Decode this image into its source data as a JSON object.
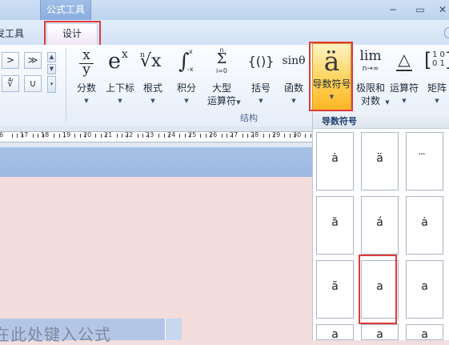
{
  "titlebar": {
    "context_tab": "公式工具",
    "minimize": "−",
    "restore": "▭",
    "close": "✕"
  },
  "tabs": {
    "developer": "发工具",
    "design": "设计"
  },
  "symbol_buttons": [
    ">",
    "≫",
    "∜",
    "∪"
  ],
  "ribbon": {
    "group_label": "结构",
    "buttons": [
      {
        "id": "fraction",
        "glyph": "x/y",
        "label": "分数"
      },
      {
        "id": "script",
        "glyph": "eˣ",
        "label": "上下标"
      },
      {
        "id": "radical",
        "glyph": "ⁿ√x",
        "label": "根式"
      },
      {
        "id": "integral",
        "glyph": "∫",
        "label": "积分"
      },
      {
        "id": "large-operator",
        "glyph": "Σ",
        "label": "大型\n运算符"
      },
      {
        "id": "bracket",
        "glyph": "{()}",
        "label": "括号"
      },
      {
        "id": "function",
        "glyph": "sinθ",
        "label": "函数"
      },
      {
        "id": "accent",
        "glyph": "ä",
        "label": "导数符号"
      },
      {
        "id": "limit-log",
        "glyph": "lim",
        "label": "极限和\n对数"
      },
      {
        "id": "operator",
        "glyph": "△",
        "label": "运算符"
      },
      {
        "id": "matrix",
        "glyph": "[10]",
        "label": "矩阵"
      }
    ]
  },
  "ruler_numbers": [
    "6",
    "17",
    "18",
    "19",
    "20",
    "21",
    "22",
    "23",
    "24",
    "25",
    "26",
    "27",
    "28",
    "29",
    "30",
    "31"
  ],
  "document": {
    "equation_placeholder": "在此处键入公式"
  },
  "gallery": {
    "title": "导数符号",
    "items": [
      "ȧ",
      "ä",
      "⃛",
      "ă",
      "á",
      "ȧ",
      "ã",
      "a",
      "a",
      "a",
      "a",
      "a"
    ]
  }
}
